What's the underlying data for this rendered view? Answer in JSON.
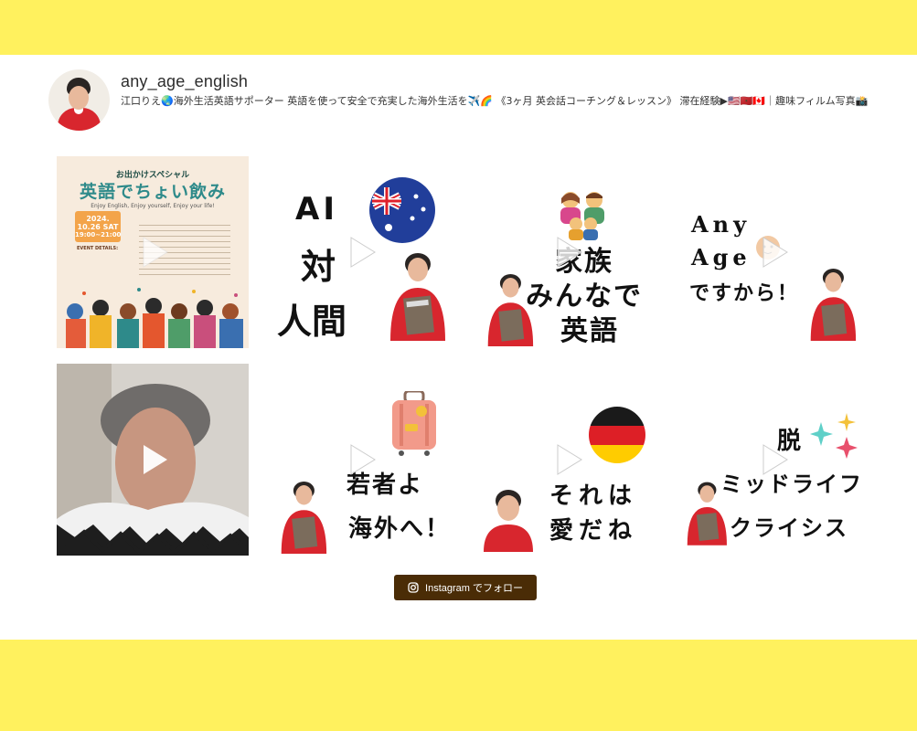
{
  "profile": {
    "username": "any_age_english",
    "bio": "江口りえ🌏海外生活英語サポーター 英語を使って安全で充実した海外生活を✈️🌈 《3ヶ月 英会話コーチング＆レッスン》 滞在経験▶🇺🇸🇲🇦🇨🇦｜趣味フィルム写真📸"
  },
  "posts": [
    {
      "type": "flyer",
      "small_title": "お出かけスペシャル",
      "big_title": "英語でちょい飲み",
      "tagline": "Enjoy English, Enjoy yourself, Enjoy your life!",
      "date_line1": "2024. 10.26 SAT",
      "date_line2": "19:00~21:00",
      "details_label": "EVENT DETAILS:"
    },
    {
      "type": "sticker",
      "lines": [
        "AI",
        "対",
        "人間"
      ]
    },
    {
      "type": "sticker",
      "lines": [
        "家族",
        "みんなで",
        "英語"
      ]
    },
    {
      "type": "sticker",
      "lines": [
        "Any",
        "Age",
        "ですから！"
      ]
    },
    {
      "type": "video"
    },
    {
      "type": "sticker",
      "lines": [
        "若者よ",
        "海外へ！"
      ]
    },
    {
      "type": "sticker",
      "lines": [
        "それは",
        "愛だね"
      ]
    },
    {
      "type": "sticker",
      "lines": [
        "脱",
        "ミッドライフ",
        "クライシス"
      ]
    }
  ],
  "follow_button": {
    "icon": "instagram-icon",
    "label": "Instagram でフォロー",
    "color": "#4a2c06"
  },
  "colors": {
    "background": "#fff15e",
    "panel": "#ffffff",
    "accent_red": "#d8262e"
  }
}
